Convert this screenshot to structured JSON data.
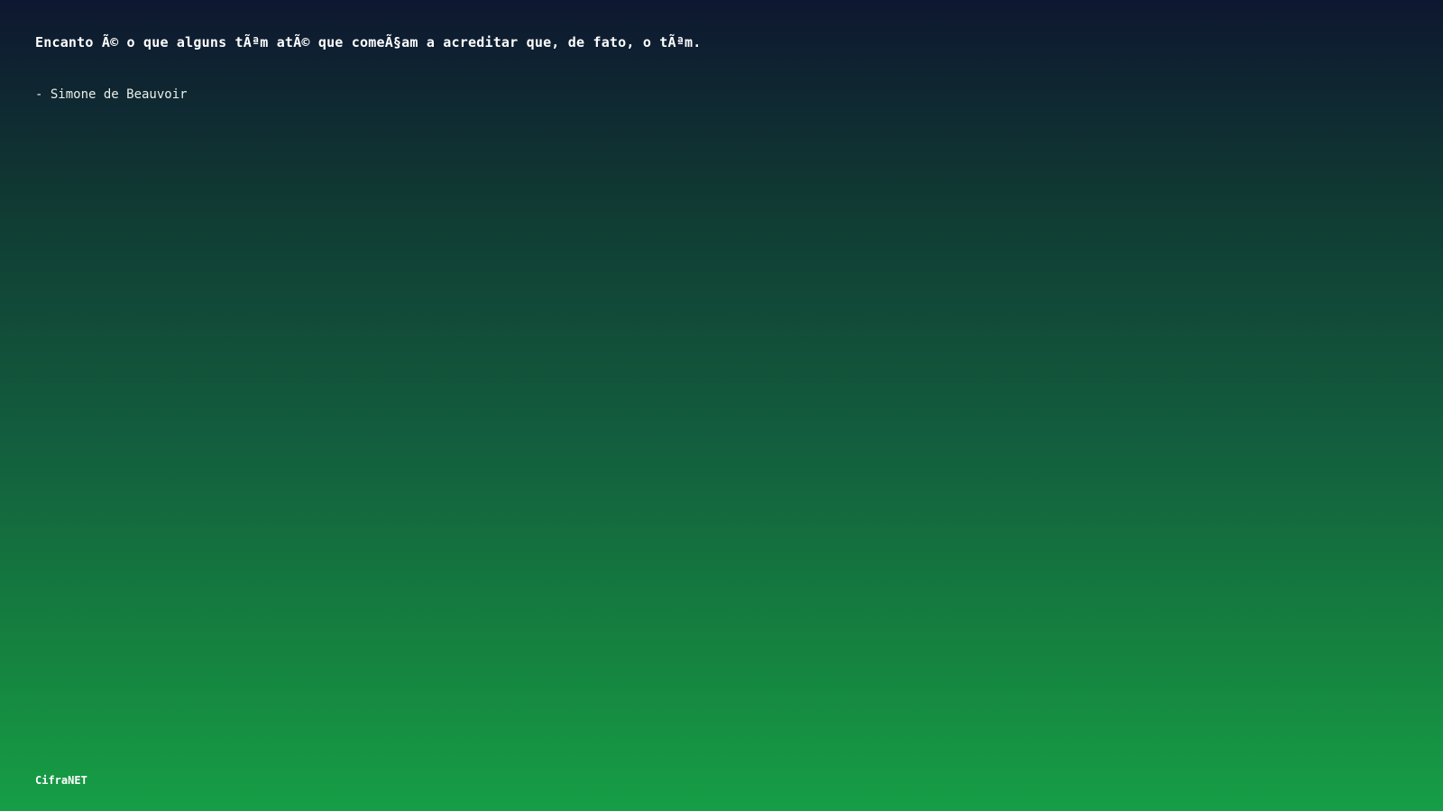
{
  "quote": {
    "text": "Encanto Ã© o que alguns tÃªm atÃ© que comeÃ§am a acreditar que, de fato, o tÃªm.",
    "author": "- Simone de Beauvoir"
  },
  "footer": {
    "brand": "CifraNET"
  },
  "colors": {
    "gradient_top": "#0e1730",
    "gradient_bottom": "#169e46",
    "text": "#ffffff"
  }
}
